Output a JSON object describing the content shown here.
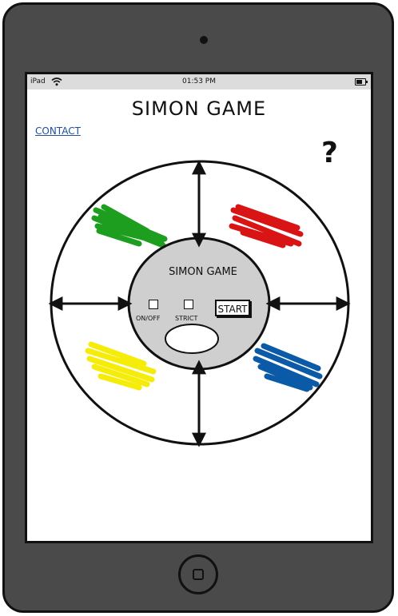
{
  "statusbar": {
    "carrier": "iPad",
    "time": "01:53 PM"
  },
  "page": {
    "title": "SIMON GAME",
    "contact_link": "CONTACT",
    "help_symbol": "?"
  },
  "game": {
    "center_title": "SIMON GAME",
    "onoff_label": "ON/OFF",
    "strict_label": "STRICT",
    "start_label": "START",
    "pads": [
      {
        "name": "green",
        "color": "#1e9e1e"
      },
      {
        "name": "red",
        "color": "#d91414"
      },
      {
        "name": "yellow",
        "color": "#f5ec0a"
      },
      {
        "name": "blue",
        "color": "#0b5aa8"
      }
    ]
  },
  "colors": {
    "device": "#4a4a4a",
    "center_disc": "#cfcfcf",
    "link": "#1d4f9c"
  },
  "icons": [
    "wifi-icon",
    "battery-icon",
    "help-icon",
    "home-button-icon",
    "camera-icon"
  ]
}
